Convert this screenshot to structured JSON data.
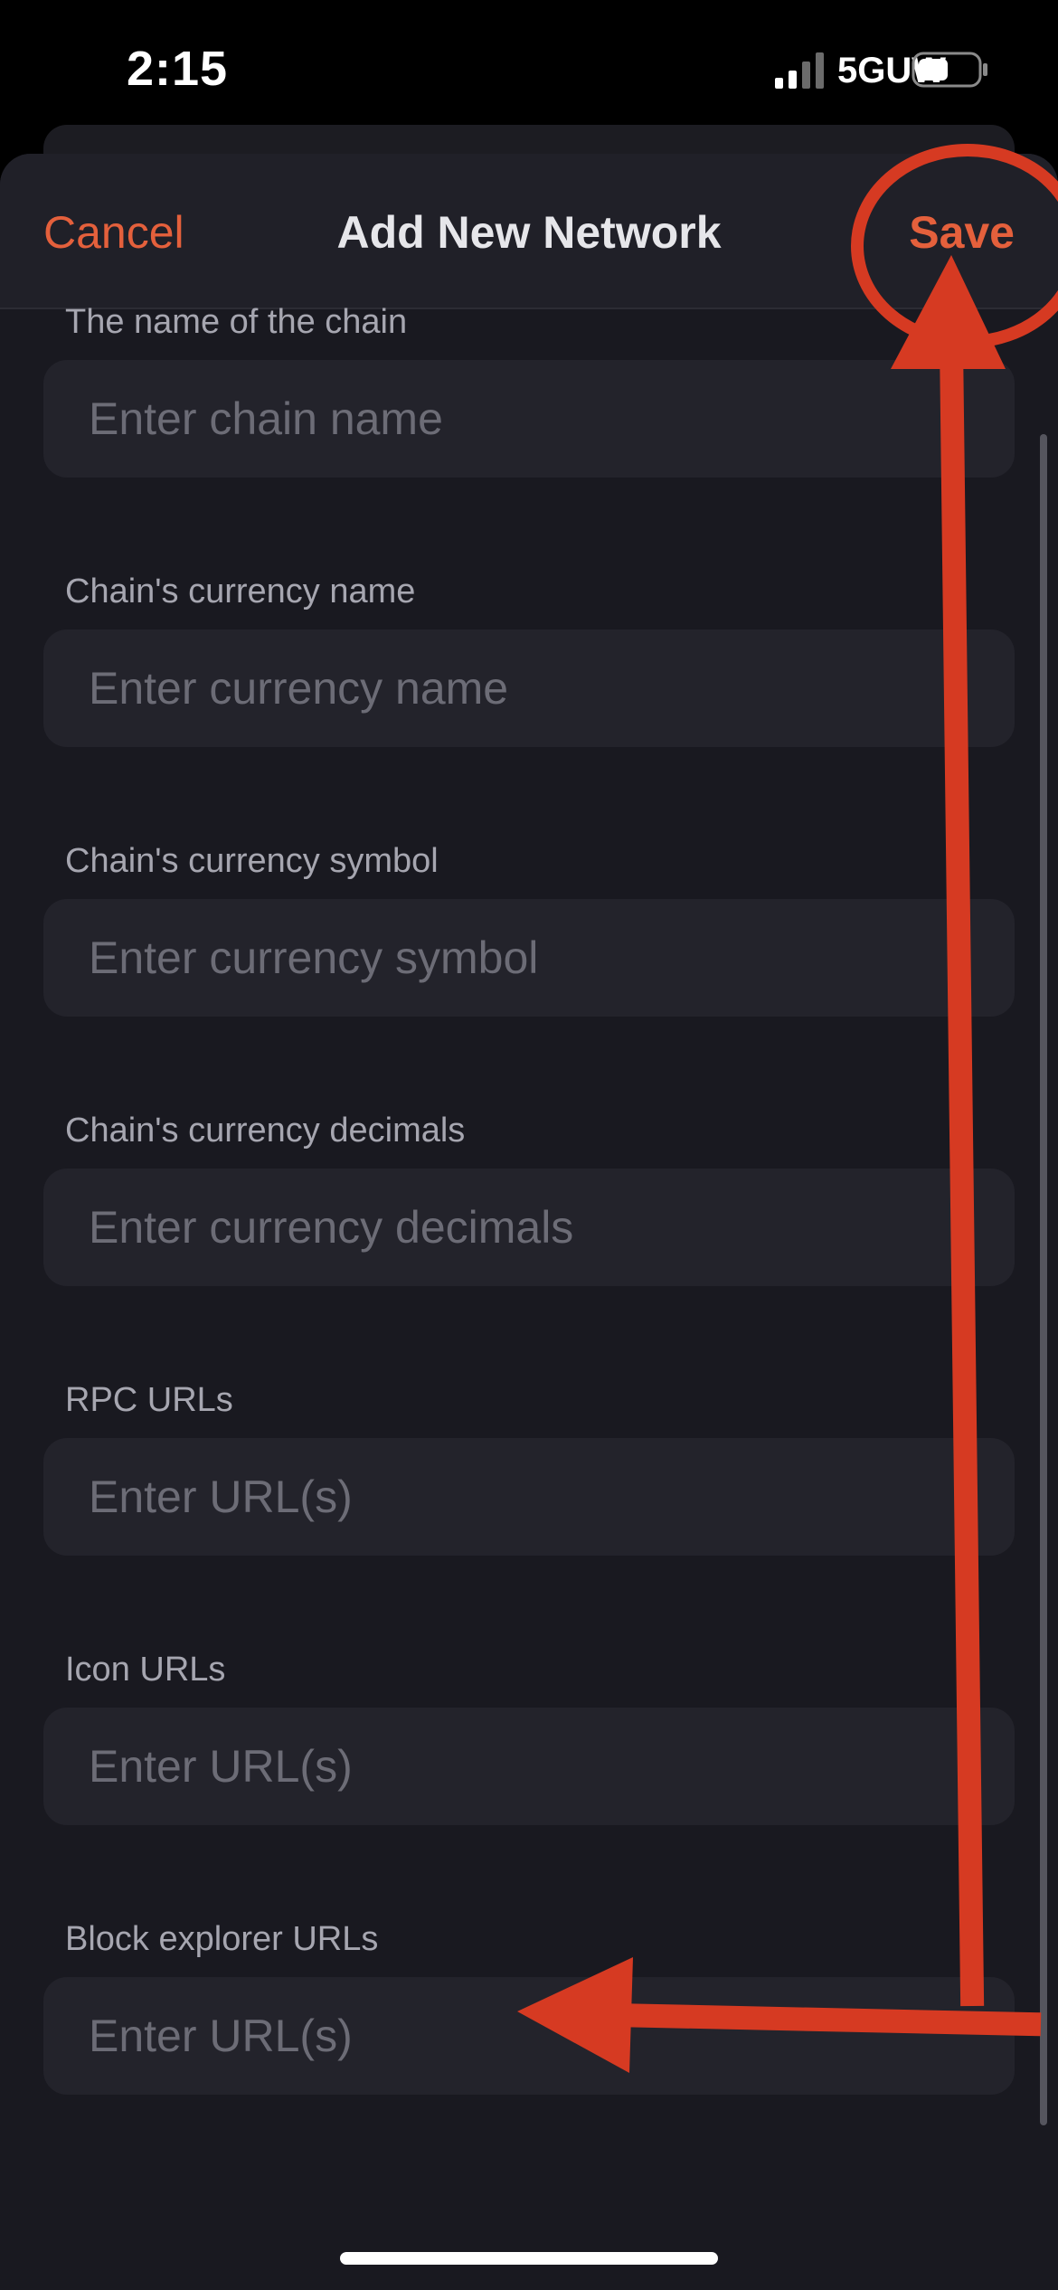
{
  "status_bar": {
    "time": "2:15",
    "network": "5GUW",
    "signal_icon": "cellular-signal-icon",
    "battery_icon": "battery-icon"
  },
  "nav": {
    "cancel_label": "Cancel",
    "title": "Add New Network",
    "save_label": "Save"
  },
  "fields": [
    {
      "label": "The name of the chain",
      "placeholder": "Enter chain name",
      "value": ""
    },
    {
      "label": "Chain's currency name",
      "placeholder": "Enter currency name",
      "value": ""
    },
    {
      "label": "Chain's currency symbol",
      "placeholder": "Enter currency symbol",
      "value": ""
    },
    {
      "label": "Chain's currency decimals",
      "placeholder": "Enter currency decimals",
      "value": ""
    },
    {
      "label": "RPC URLs",
      "placeholder": "Enter URL(s)",
      "value": ""
    },
    {
      "label": "Icon URLs",
      "placeholder": "Enter URL(s)",
      "value": ""
    },
    {
      "label": "Block explorer URLs",
      "placeholder": "Enter URL(s)",
      "value": ""
    }
  ],
  "colors": {
    "accent": "#e4603c",
    "annotation": "#d63a22",
    "background": "#191920",
    "input_background": "#23232b"
  }
}
